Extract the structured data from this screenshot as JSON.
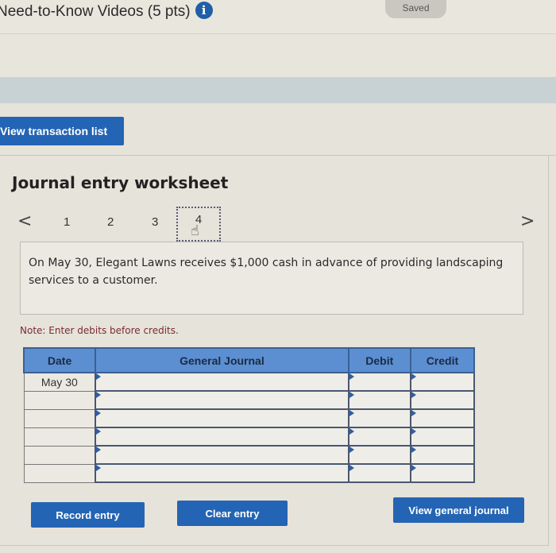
{
  "header": {
    "title": "Need-to-Know Videos (5 pts)",
    "info_icon": "i",
    "saved_label": "Saved"
  },
  "toolbar": {
    "view_transaction_list": "View transaction list"
  },
  "worksheet": {
    "title": "Journal entry worksheet",
    "prev_arrow": "<",
    "next_arrow": ">",
    "pages": [
      "1",
      "2",
      "3",
      "4"
    ],
    "active_page": "4",
    "description": "On May 30, Elegant Lawns receives $1,000 cash in advance of providing landscaping services to a customer.",
    "note": "Note: Enter debits before credits."
  },
  "journal_table": {
    "columns": [
      "Date",
      "General Journal",
      "Debit",
      "Credit"
    ],
    "rows": [
      {
        "date": "May 30",
        "account": "",
        "debit": "",
        "credit": ""
      },
      {
        "date": "",
        "account": "",
        "debit": "",
        "credit": ""
      },
      {
        "date": "",
        "account": "",
        "debit": "",
        "credit": ""
      },
      {
        "date": "",
        "account": "",
        "debit": "",
        "credit": ""
      },
      {
        "date": "",
        "account": "",
        "debit": "",
        "credit": ""
      },
      {
        "date": "",
        "account": "",
        "debit": "",
        "credit": ""
      }
    ]
  },
  "actions": {
    "record_entry": "Record entry",
    "clear_entry": "Clear entry",
    "view_general_journal": "View general journal"
  },
  "colors": {
    "primary_button": "#2464b4",
    "table_header": "#5b8fd2",
    "info_icon": "#1f5fa8",
    "note_text": "#7a2b30"
  }
}
